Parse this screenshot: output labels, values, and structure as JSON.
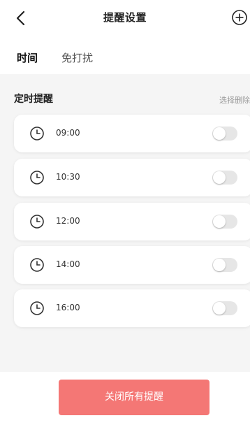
{
  "header": {
    "title": "提醒设置",
    "back_icon": "chevron-left-icon",
    "add_icon": "plus-circle-icon"
  },
  "tabs": [
    {
      "label": "时间",
      "active": true
    },
    {
      "label": "免打扰",
      "active": false
    }
  ],
  "section": {
    "title": "定时提醒",
    "action_label": "选择删除"
  },
  "reminders": [
    {
      "time": "09:00",
      "enabled": false
    },
    {
      "time": "10:30",
      "enabled": false
    },
    {
      "time": "12:00",
      "enabled": false
    },
    {
      "time": "14:00",
      "enabled": false
    },
    {
      "time": "16:00",
      "enabled": false
    }
  ],
  "footer": {
    "close_all_label": "关闭所有提醒"
  },
  "colors": {
    "accent": "#f47775",
    "background": "#f5f5f5"
  }
}
